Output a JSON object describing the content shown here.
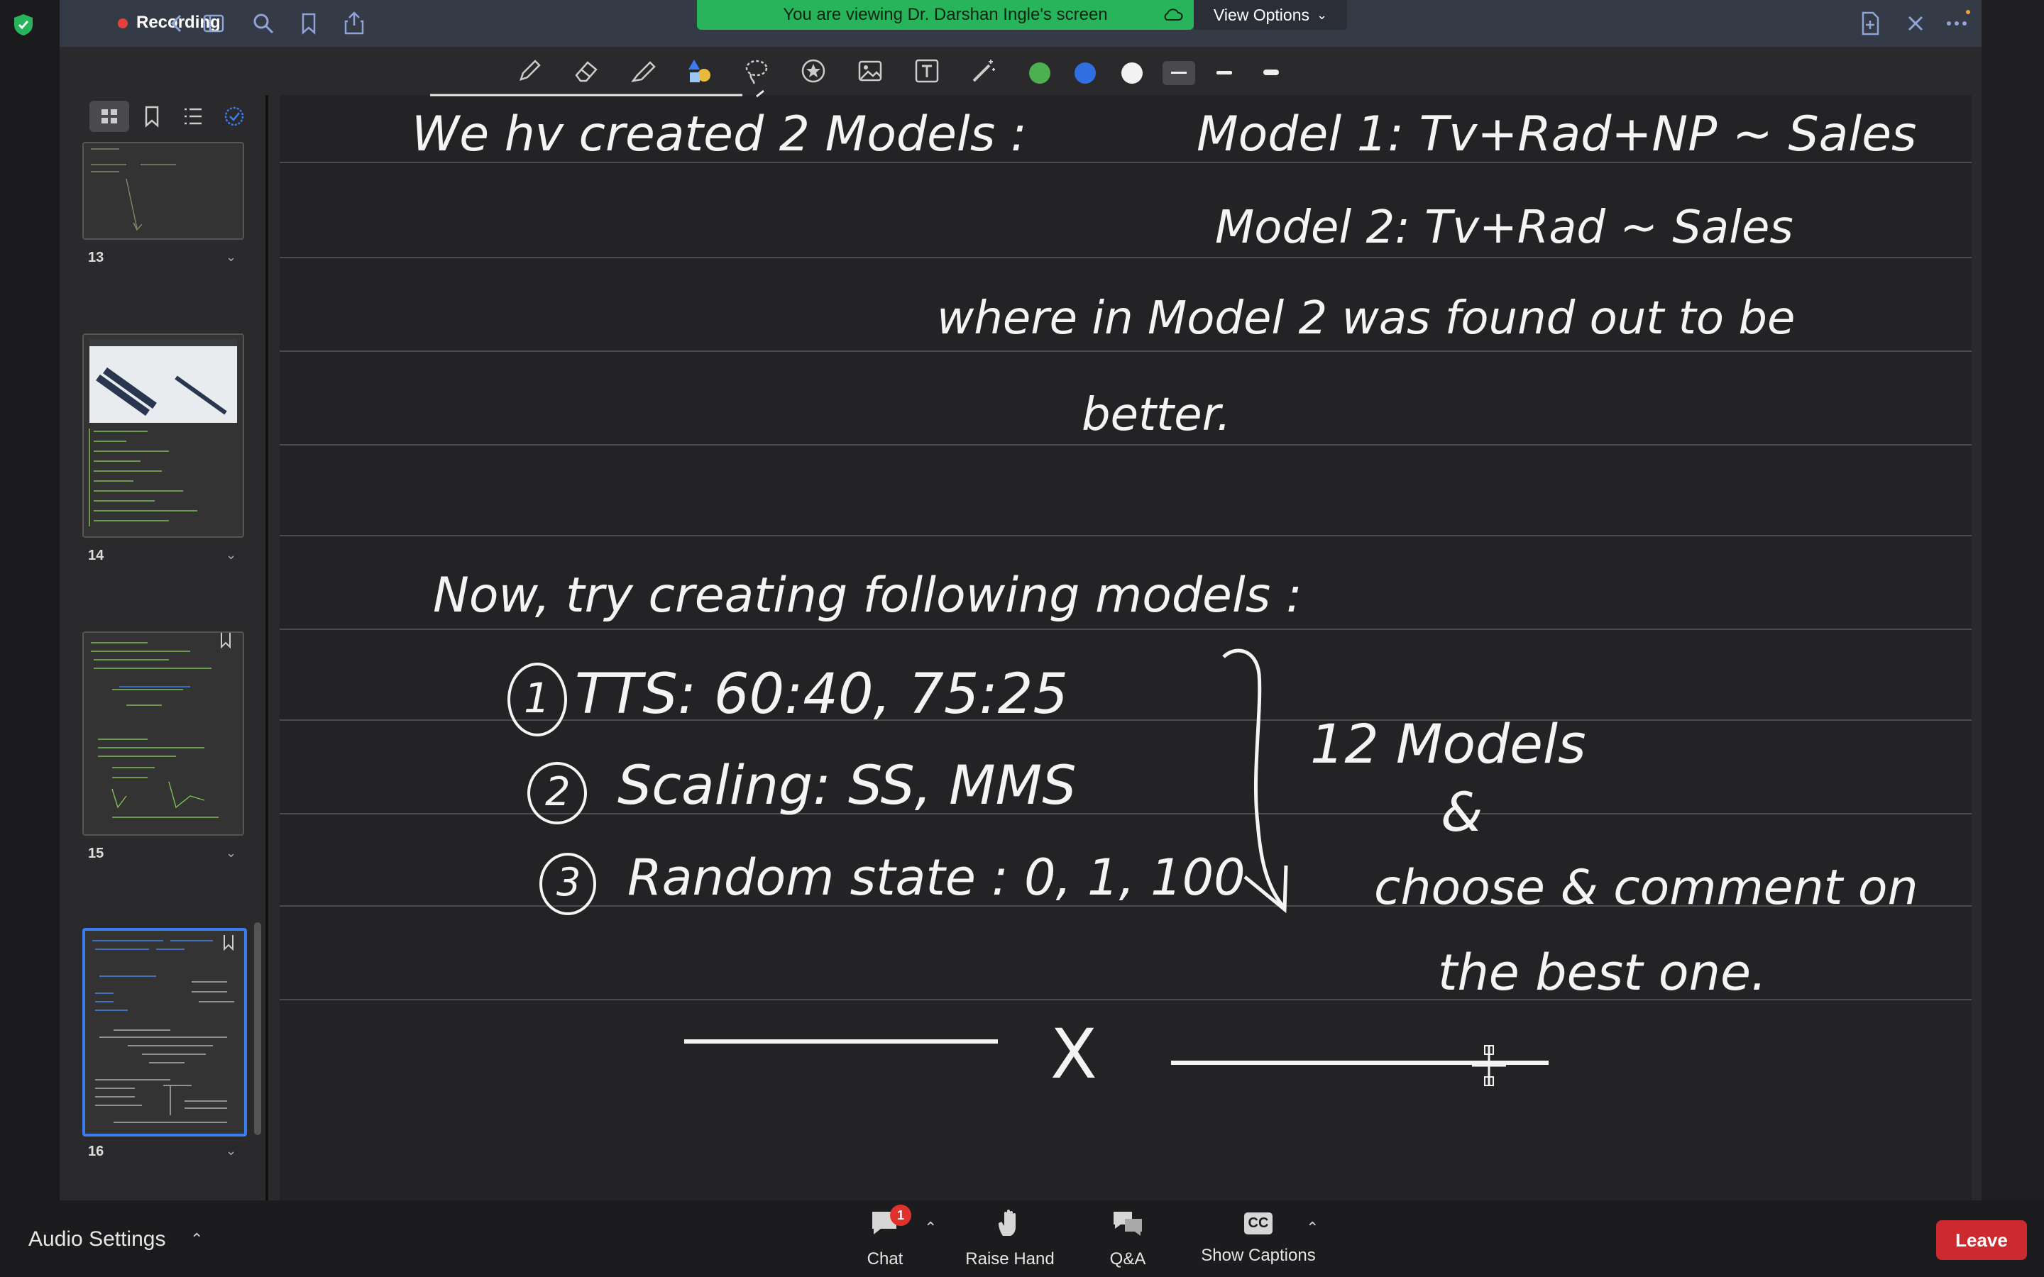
{
  "app": {
    "recording_label": "Recording",
    "banner_text": "You are viewing Dr. Darshan Ingle's screen",
    "view_options_label": "View Options"
  },
  "toolbar": {
    "colors": [
      "#4caf50",
      "#2f6fdf",
      "#f2f2f2"
    ],
    "accent": "#27b45a"
  },
  "sidebar": {
    "pages": [
      {
        "number": "13",
        "selected": false
      },
      {
        "number": "14",
        "selected": false
      },
      {
        "number": "15",
        "selected": false
      },
      {
        "number": "16",
        "selected": true
      }
    ]
  },
  "notes": {
    "line1_a": "We hv created 2 Models :",
    "line1_b": "Model 1: Tv+Rad+NP ~ Sales",
    "line2": "Model 2: Tv+Rad ~ Sales",
    "line3": "where in Model 2 was found out to be",
    "line4": "better.",
    "line5": "Now, try creating following models :",
    "item1": "TTS: 60:40, 75:25",
    "item2": "Scaling: SS, MMS",
    "item3": "Random state : 0, 1, 100",
    "item1_num": "1",
    "item2_num": "2",
    "item3_num": "3",
    "result1": "12 Models",
    "result2": "&",
    "result3": "choose & comment on",
    "result4": "the best one.",
    "separator_x": "X"
  },
  "bottom": {
    "audio_settings": "Audio Settings",
    "chat": "Chat",
    "chat_badge": "1",
    "raise_hand": "Raise Hand",
    "qa": "Q&A",
    "show_captions": "Show Captions",
    "cc": "CC",
    "leave": "Leave"
  }
}
